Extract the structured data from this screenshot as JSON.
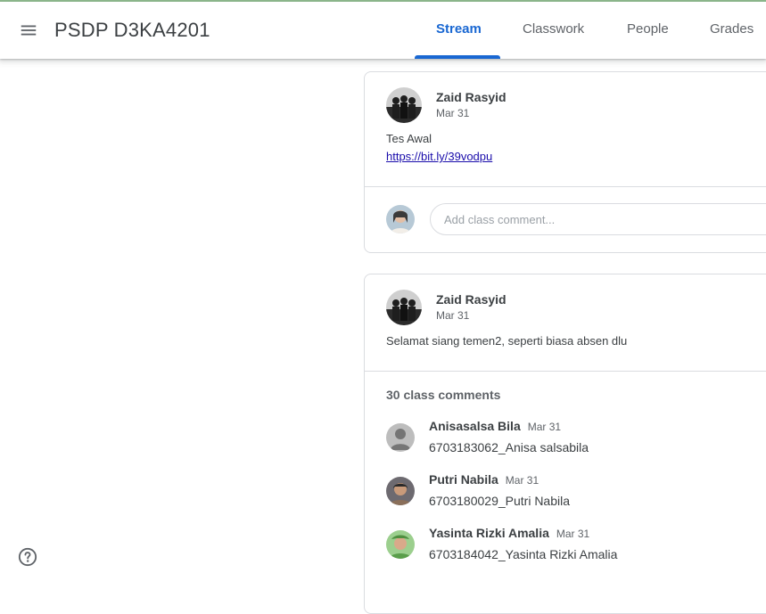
{
  "header": {
    "title": "PSDP D3KA4201",
    "tabs": [
      {
        "label": "Stream",
        "active": true
      },
      {
        "label": "Classwork",
        "active": false
      },
      {
        "label": "People",
        "active": false
      },
      {
        "label": "Grades",
        "active": false
      }
    ]
  },
  "posts": [
    {
      "author": "Zaid Rasyid",
      "date": "Mar 31",
      "text": "Tes Awal",
      "link": "https://bit.ly/39vodpu",
      "comment_placeholder": "Add class comment..."
    },
    {
      "author": "Zaid Rasyid",
      "date": "Mar 31",
      "text": "Selamat siang temen2, seperti biasa absen dlu",
      "comments_count": "30 class comments",
      "comments": [
        {
          "name": "Anisasalsa Bila",
          "date": "Mar 31",
          "text": "6703183062_Anisa salsabila"
        },
        {
          "name": "Putri Nabila",
          "date": "Mar 31",
          "text": "6703180029_Putri Nabila"
        },
        {
          "name": "Yasinta Rizki Amalia",
          "date": "Mar 31",
          "text": "6703184042_Yasinta Rizki Amalia"
        }
      ]
    }
  ],
  "icons": {
    "menu": "menu-icon",
    "help": "help-icon"
  },
  "colors": {
    "accent": "#1967d2",
    "border": "#dadce0",
    "link": "#1a0dab"
  }
}
